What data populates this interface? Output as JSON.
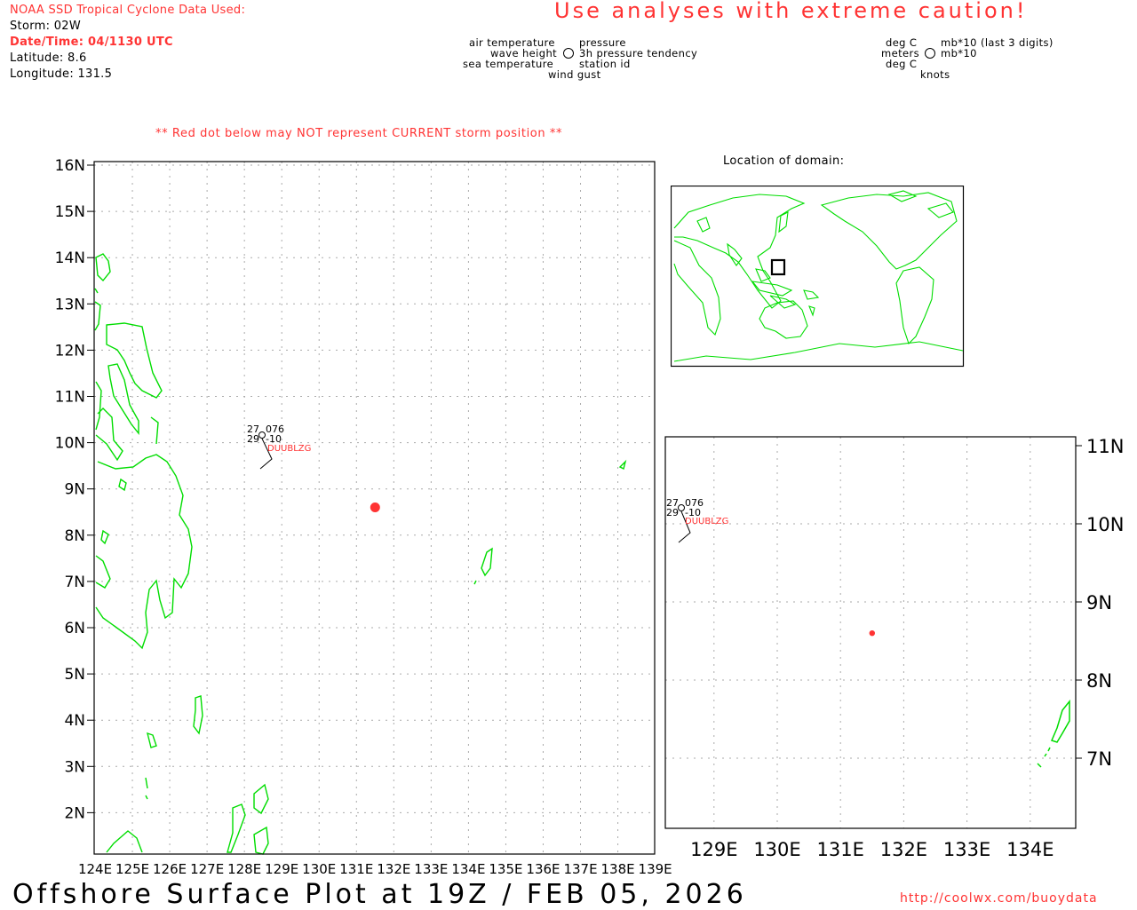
{
  "header": {
    "title": "NOAA SSD Tropical Cyclone Data Used:",
    "storm": "Storm: 02W",
    "datetime": "Date/Time: 04/1130 UTC",
    "latitude": "Latitude: 8.6",
    "longitude": "Longitude: 131.5",
    "caution": "Use analyses with extreme caution!"
  },
  "legend": {
    "left": [
      "air temperature",
      "wave height",
      "sea temperature"
    ],
    "right": [
      "pressure",
      "3h pressure tendency",
      "station id"
    ],
    "bottom": "wind gust",
    "units_left": [
      "deg C",
      "meters",
      "deg C"
    ],
    "units_right": [
      "mb*10 (last 3 digits)",
      "mb*10",
      "knots"
    ]
  },
  "notice": "** Red dot below may NOT represent CURRENT storm position **",
  "main_map": {
    "lat_labels": [
      "16N",
      "15N",
      "14N",
      "13N",
      "12N",
      "11N",
      "10N",
      "9N",
      "8N",
      "7N",
      "6N",
      "5N",
      "4N",
      "3N",
      "2N"
    ],
    "lon_labels": [
      "124E",
      "125E",
      "126E",
      "127E",
      "128E",
      "129E",
      "130E",
      "131E",
      "132E",
      "133E",
      "134E",
      "135E",
      "136E",
      "137E",
      "138E",
      "139E"
    ]
  },
  "station": {
    "air_temp": "27",
    "pressure": "076",
    "sea_temp": "29",
    "tendency": "-10",
    "id": "DUUBLZG"
  },
  "storm_position": {
    "lat": 8.6,
    "lon": 131.5
  },
  "locator": {
    "title": "Location of domain:"
  },
  "zoom_map": {
    "lat_labels": [
      "11N",
      "10N",
      "9N",
      "8N",
      "7N"
    ],
    "lon_labels": [
      "129E",
      "130E",
      "131E",
      "132E",
      "133E",
      "134E"
    ]
  },
  "footer": {
    "title": "Offshore Surface Plot at 19Z / FEB 05, 2026",
    "url": "http://coolwx.com/buoydata"
  },
  "colors": {
    "land": "#00dd00",
    "alert": "#ff3333",
    "grid": "#aaaaaa",
    "frame": "#000000"
  }
}
